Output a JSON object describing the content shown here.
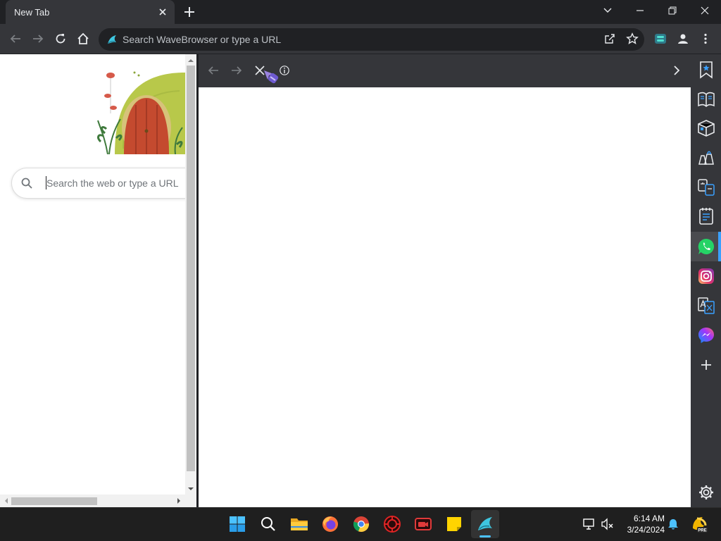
{
  "browser": {
    "tab_title": "New Tab",
    "omnibox_placeholder": "Search WaveBrowser or type a URL"
  },
  "newtab": {
    "search_placeholder": "Search the web or type a URL"
  },
  "sidebar": {
    "items": [
      "bookmark-icon",
      "book-icon",
      "package-icon",
      "shopping-icon",
      "translate-app-icon",
      "notes-icon",
      "whatsapp-icon",
      "instagram-icon",
      "translate-icon",
      "messenger-icon",
      "add-icon",
      "settings-icon"
    ],
    "active_item": "whatsapp-icon"
  },
  "taskbar": {
    "time": "6:14 AM",
    "date": "3/24/2024",
    "apps": [
      "start",
      "search",
      "file-explorer",
      "firefox",
      "chrome",
      "app-red",
      "camera-app",
      "sticky-notes",
      "wavebrowser"
    ]
  },
  "colors": {
    "accent": "#3aa0ff",
    "door": "#c44a2f",
    "hill": "#b8c84a"
  }
}
